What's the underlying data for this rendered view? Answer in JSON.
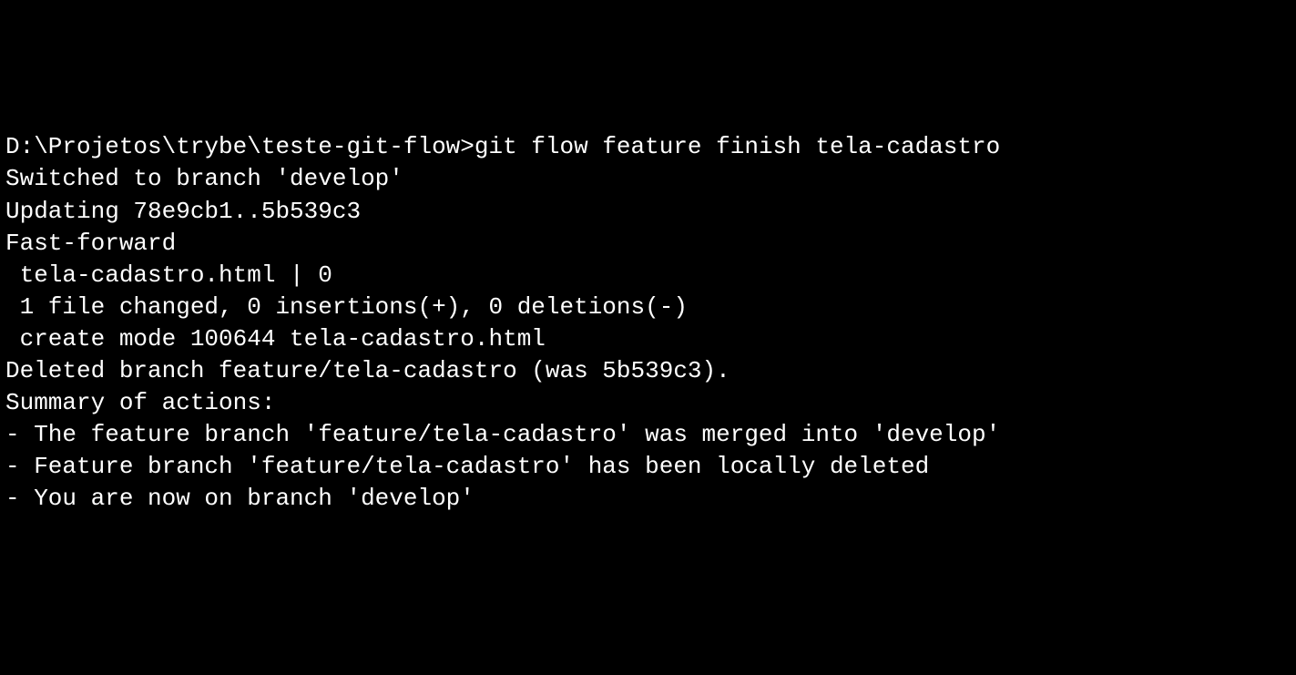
{
  "terminal": {
    "prompt": "D:\\Projetos\\trybe\\teste-git-flow>",
    "command": "git flow feature finish tela-cadastro",
    "output": {
      "line1": "Switched to branch 'develop'",
      "line2": "Updating 78e9cb1..5b539c3",
      "line3": "Fast-forward",
      "line4": " tela-cadastro.html | 0",
      "line5": " 1 file changed, 0 insertions(+), 0 deletions(-)",
      "line6": " create mode 100644 tela-cadastro.html",
      "line7": "Deleted branch feature/tela-cadastro (was 5b539c3).",
      "line8": "",
      "line9": "Summary of actions:",
      "line10": "- The feature branch 'feature/tela-cadastro' was merged into 'develop'",
      "line11": "- Feature branch 'feature/tela-cadastro' has been locally deleted",
      "line12": "- You are now on branch 'develop'"
    }
  }
}
